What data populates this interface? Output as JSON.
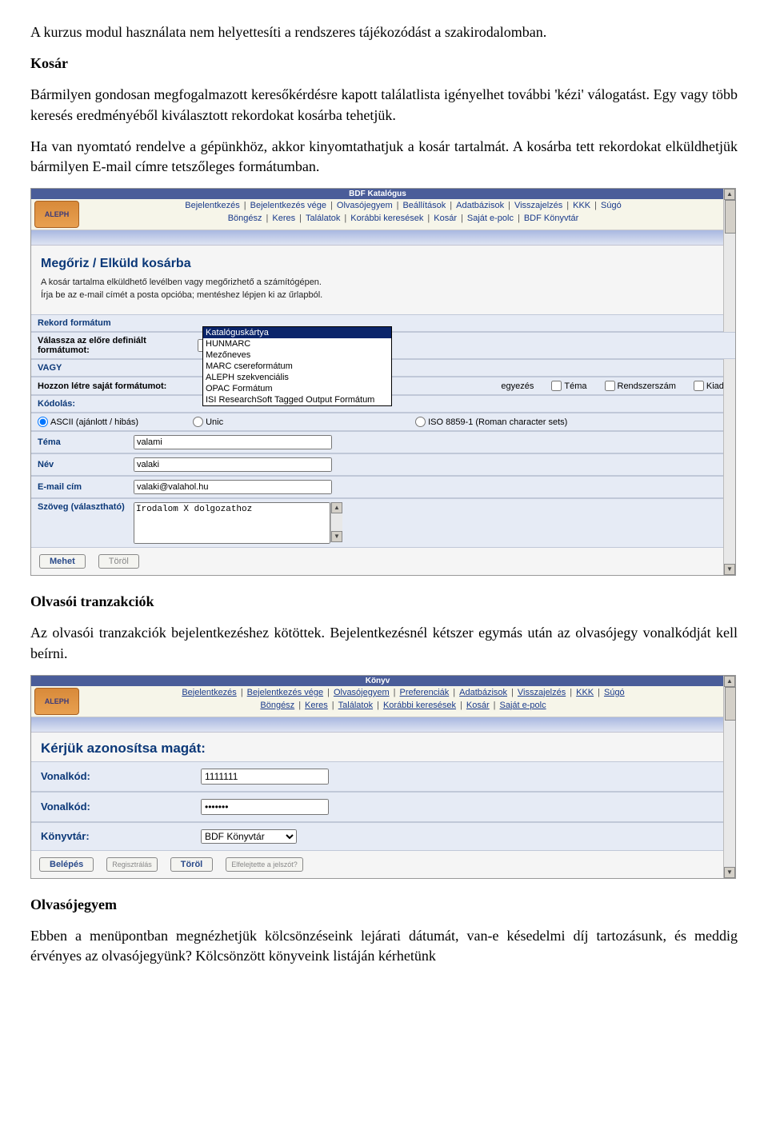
{
  "doc": {
    "intro": "A kurzus modul használata nem helyettesíti a rendszeres tájékozódást a szakirodalomban.",
    "kosar_h": "Kosár",
    "kosar_p1": "Bármilyen gondosan megfogalmazott keresőkérdésre kapott találatlista igényelhet további 'kézi' válogatást. Egy vagy több keresés eredményéből kiválasztott rekordokat kosárba tehetjük.",
    "kosar_p2": "Ha van nyomtató rendelve a gépünkhöz, akkor kinyomtathatjuk a kosár tartalmát. A kosárba tett rekordokat elküldhetjük bármilyen E-mail címre tetszőleges formátumban.",
    "tranz_h": "Olvasói tranzakciók",
    "tranz_p": "Az olvasói tranzakciók bejelentkezéshez kötöttek. Bejelentkezésnél kétszer egymás után az olvasójegy vonalkódját kell beírni.",
    "ojegy_h": "Olvasójegyem",
    "ojegy_p": "Ebben a menüpontban megnézhetjük kölcsönzéseink lejárati dátumát, van-e késedelmi díj tartozásunk, és meddig érvényes az olvasójegyünk? Kölcsönzött könyveink listáján kérhetünk"
  },
  "s1": {
    "title_bar": "BDF Katalógus",
    "nav_row1": [
      "Bejelentkezés",
      "Bejelentkezés vége",
      "Olvasójegyem",
      "Beállítások",
      "Adatbázisok",
      "Visszajelzés",
      "KKK",
      "Súgó"
    ],
    "nav_row2": [
      "Böngész",
      "Keres",
      "Találatok",
      "Korábbi keresések",
      "Kosár",
      "Saját e-polc",
      "BDF Könyvtár"
    ],
    "heading": "Megőriz / Elküld kosárba",
    "sub1": "A kosár tartalma elküldhető levélben vagy megőrizhető a számítógépen.",
    "sub2": "Írja be az e-mail címét a posta opcióba; mentéshez lépjen ki az űrlapból.",
    "rekord_format": "Rekord formátum",
    "valassza": "Válassza az előre definiált formátumot:",
    "format_selected": "Katalóguskártya",
    "format_options": [
      "Katalóguskártya",
      "HUNMARC",
      "Mezőneves",
      "MARC csereformátum",
      "ALEPH szekvenciális",
      "OPAC Formátum",
      "ISI ResearchSoft Tagged Output Formátum"
    ],
    "vagy": "VAGY",
    "hozzon": "Hozzon létre saját formátumot:",
    "chk_right": [
      "egyezés",
      "Téma",
      "Rendszerszám",
      "Kiadó"
    ],
    "kodolas": "Kódolás:",
    "enc1": "ASCII (ajánlott / hibás)",
    "enc2": "Unic",
    "enc3": "ISO 8859-1 (Roman character sets)",
    "tema": "Téma",
    "nev": "Név",
    "email": "E-mail cím",
    "szoveg": "Szöveg (választható)",
    "tema_val": "valami",
    "nev_val": "valaki",
    "email_val": "valaki@valahol.hu",
    "szoveg_val": "Irodalom X dolgozathoz",
    "btn_go": "Mehet",
    "btn_clear": "Töröl",
    "logo": "ALEPH"
  },
  "s2": {
    "title_bar": "Könyv",
    "nav_row1": [
      "Bejelentkezés",
      "Bejelentkezés vége",
      "Olvasójegyem",
      "Preferenciák",
      "Adatbázisok",
      "Visszajelzés",
      "KKK",
      "Súgó"
    ],
    "nav_row2": [
      "Böngész",
      "Keres",
      "Találatok",
      "Korábbi keresések",
      "Kosár",
      "Saját e-polc"
    ],
    "heading": "Kérjük azonosítsa magát:",
    "vonalkod": "Vonalkód:",
    "konyvtar": "Könyvtár:",
    "vk_val": "1111111",
    "pw_val": "•••••••",
    "lib_val": "BDF Könyvtár",
    "btn_login": "Belépés",
    "btn_reg": "Regisztrálás",
    "btn_clear": "Töröl",
    "btn_forgot": "Elfelejtette a jelszót?",
    "logo": "ALEPH"
  }
}
